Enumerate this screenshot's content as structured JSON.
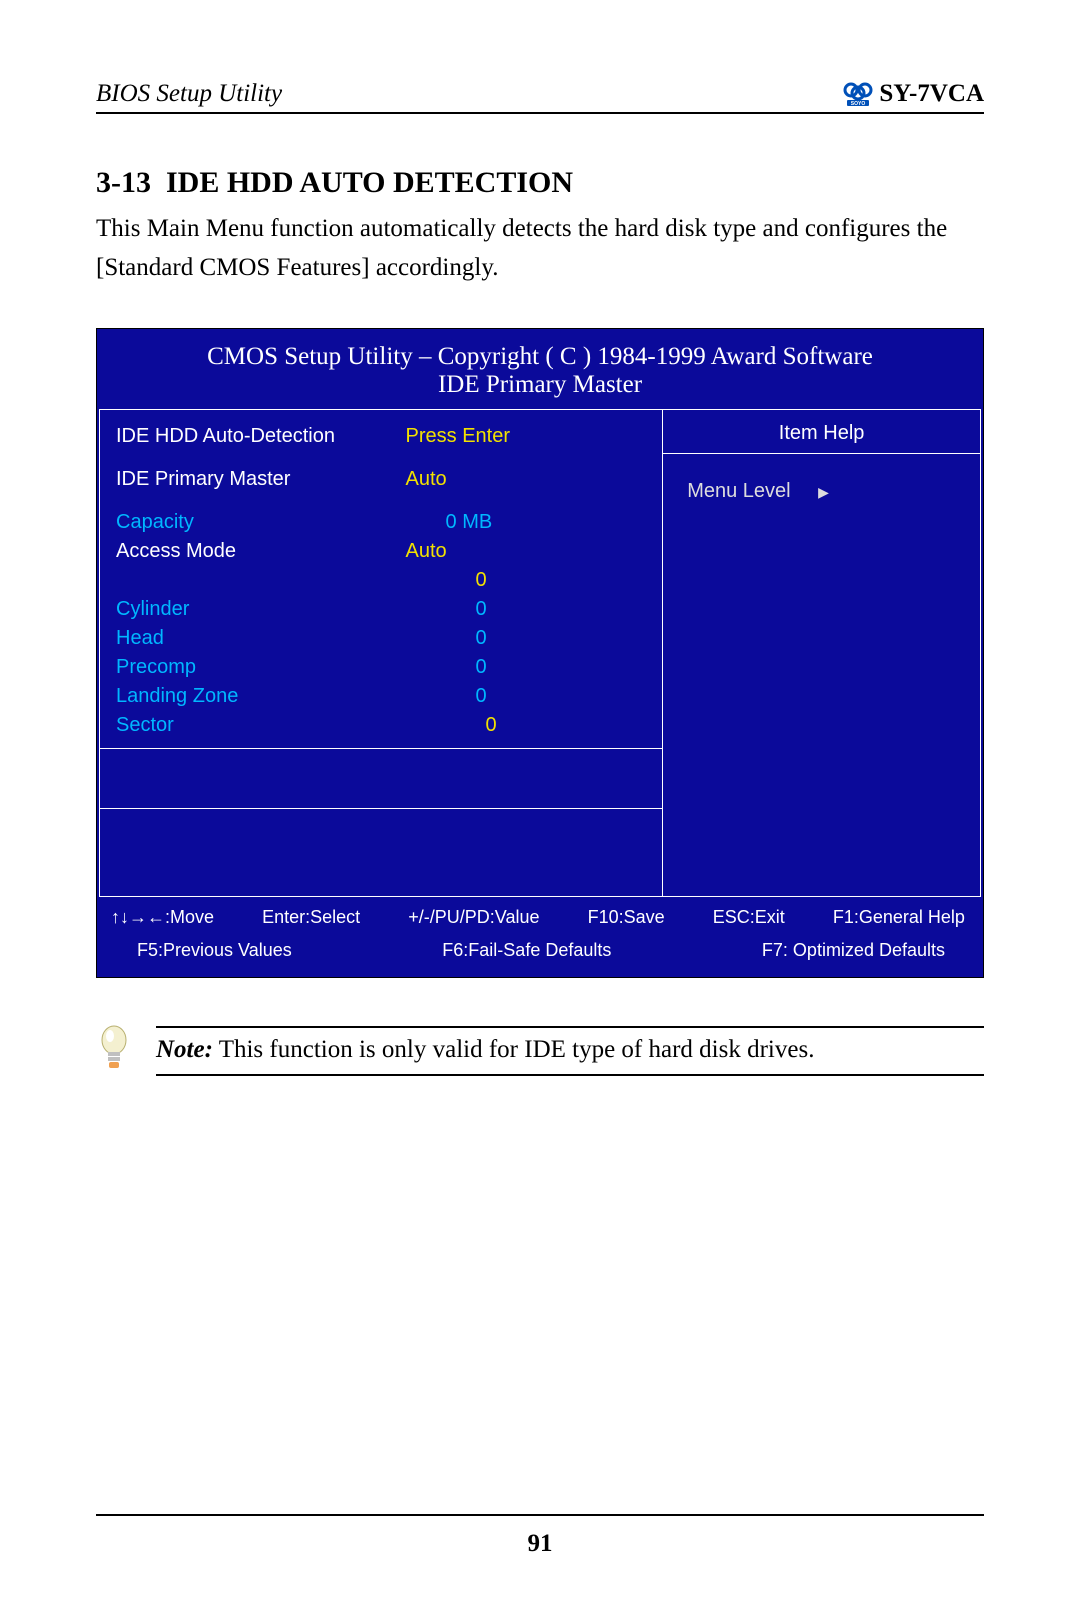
{
  "header": {
    "left": "BIOS Setup Utility",
    "right": "SY-7VCA",
    "logo_label": "SOYO"
  },
  "section": {
    "number": "3-13",
    "title": "IDE HDD AUTO DETECTION",
    "body": "This Main Menu function automatically detects the hard disk type and configures the [Standard CMOS Features] accordingly."
  },
  "bios": {
    "title_line1": "CMOS Setup Utility – Copyright ( C ) 1984-1999 Award Software",
    "title_line2": "IDE Primary Master",
    "rows": {
      "autodetect_label": "IDE HDD Auto-Detection",
      "autodetect_value": "Press Enter",
      "primary_label": "IDE Primary Master",
      "primary_value": "Auto",
      "capacity_label": "Capacity",
      "capacity_value": "0 MB",
      "access_label": "Access Mode",
      "access_value": "Auto",
      "blank_value": "0",
      "cylinder_label": "Cylinder",
      "cylinder_value": "0",
      "head_label": "Head",
      "head_value": "0",
      "precomp_label": "Precomp",
      "precomp_value": "0",
      "landing_label": "Landing Zone",
      "landing_value": "0",
      "sector_label": "Sector",
      "sector_value": "0"
    },
    "help": {
      "title": "Item Help",
      "menu_level": "Menu Level"
    },
    "footer1": {
      "move": "↑↓→←:Move",
      "enter": "Enter:Select",
      "pupd": "+/-/PU/PD:Value",
      "f10": "F10:Save",
      "esc": "ESC:Exit",
      "f1": "F1:General Help"
    },
    "footer2": {
      "f5": "F5:Previous Values",
      "f6": "F6:Fail-Safe Defaults",
      "f7": "F7: Optimized Defaults"
    }
  },
  "note": {
    "label": "Note:",
    "text": " This function is only valid for IDE type of hard disk drives."
  },
  "page_number": "91"
}
